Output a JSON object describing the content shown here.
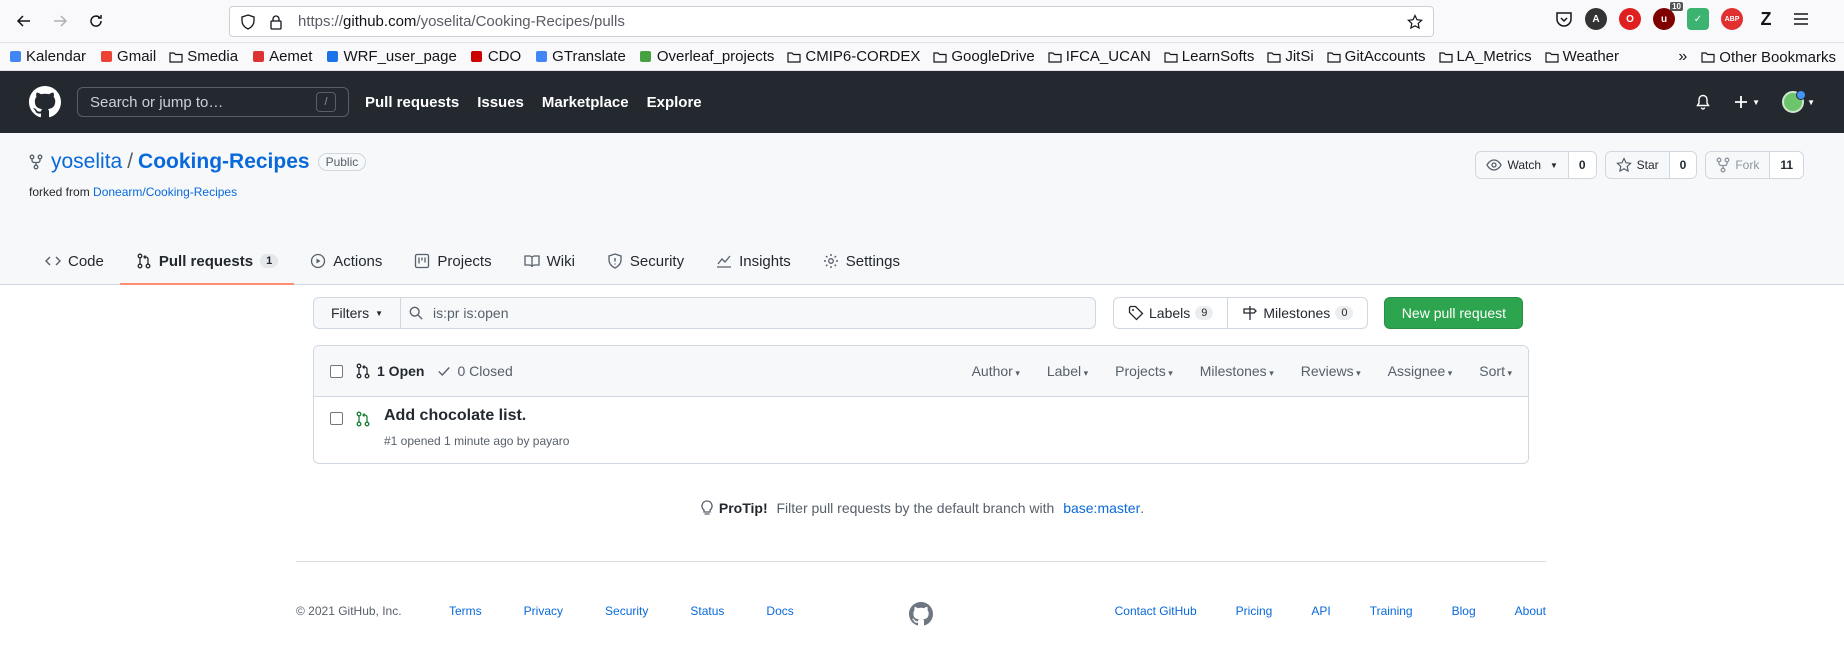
{
  "browser": {
    "url_prefix": "https://",
    "url_domain": "github.com",
    "url_path": "/yoselita/Cooking-Recipes/pulls",
    "ext_badge": "10",
    "ext_abp": "ABP"
  },
  "bookmarks": [
    {
      "label": "Kalendar",
      "icon": "calendar-icon"
    },
    {
      "label": "Gmail",
      "icon": "gmail-icon"
    },
    {
      "label": "Smedia",
      "icon": "folder-icon"
    },
    {
      "label": "Aemet",
      "icon": "aemet-icon"
    },
    {
      "label": "WRF_user_page",
      "icon": "wrf-icon"
    },
    {
      "label": "CDO",
      "icon": "cdo-icon"
    },
    {
      "label": "GTranslate",
      "icon": "translate-icon"
    },
    {
      "label": "Overleaf_projects",
      "icon": "overleaf-icon"
    },
    {
      "label": "CMIP6-CORDEX",
      "icon": "folder-icon"
    },
    {
      "label": "GoogleDrive",
      "icon": "folder-icon"
    },
    {
      "label": "IFCA_UCAN",
      "icon": "folder-icon"
    },
    {
      "label": "LearnSofts",
      "icon": "folder-icon"
    },
    {
      "label": "JitSi",
      "icon": "folder-icon"
    },
    {
      "label": "GitAccounts",
      "icon": "folder-icon"
    },
    {
      "label": "LA_Metrics",
      "icon": "folder-icon"
    },
    {
      "label": "Weather",
      "icon": "folder-icon"
    }
  ],
  "bookmarks_other": "Other Bookmarks",
  "gh": {
    "search_placeholder": "Search or jump to…",
    "search_key": "/",
    "nav": [
      "Pull requests",
      "Issues",
      "Marketplace",
      "Explore"
    ]
  },
  "repo": {
    "owner": "yoselita",
    "sep": "/",
    "name": "Cooking-Recipes",
    "visibility": "Public",
    "forked_prefix": "forked from ",
    "forked_from": "Donearm/Cooking-Recipes",
    "watch": {
      "label": "Watch",
      "count": "0"
    },
    "star": {
      "label": "Star",
      "count": "0"
    },
    "fork": {
      "label": "Fork",
      "count": "11"
    },
    "tabs": [
      {
        "label": "Code",
        "icon": "code-icon"
      },
      {
        "label": "Pull requests",
        "icon": "pull-request-icon",
        "count": "1"
      },
      {
        "label": "Actions",
        "icon": "actions-icon"
      },
      {
        "label": "Projects",
        "icon": "projects-icon"
      },
      {
        "label": "Wiki",
        "icon": "wiki-icon"
      },
      {
        "label": "Security",
        "icon": "shield-icon"
      },
      {
        "label": "Insights",
        "icon": "insights-icon"
      },
      {
        "label": "Settings",
        "icon": "gear-icon"
      }
    ]
  },
  "pulls": {
    "filters_label": "Filters",
    "query": "is:pr is:open",
    "labels": {
      "label": "Labels",
      "count": "9"
    },
    "milestones": {
      "label": "Milestones",
      "count": "0"
    },
    "new_pr": "New pull request",
    "open_label": "1 Open",
    "closed_label": "0 Closed",
    "header_filters": [
      "Author",
      "Label",
      "Projects",
      "Milestones",
      "Reviews",
      "Assignee",
      "Sort"
    ],
    "items": [
      {
        "title": "Add chocolate list.",
        "meta": "#1 opened 1 minute ago by payaro"
      }
    ]
  },
  "protip": {
    "bold": "ProTip!",
    "text": " Filter pull requests by the default branch with ",
    "link": "base:master",
    "end": "."
  },
  "footer": {
    "copyright": "© 2021 GitHub, Inc.",
    "links_left": [
      "Terms",
      "Privacy",
      "Security",
      "Status",
      "Docs"
    ],
    "links_right": [
      "Contact GitHub",
      "Pricing",
      "API",
      "Training",
      "Blog",
      "About"
    ]
  }
}
